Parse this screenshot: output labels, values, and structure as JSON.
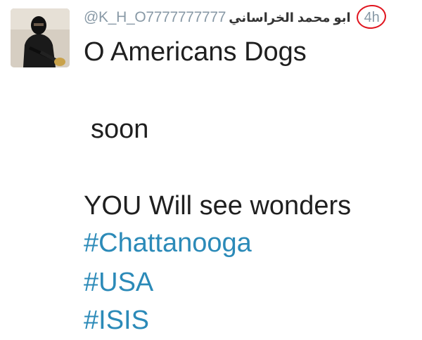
{
  "tweet": {
    "handle": "@K_H_O7777777777",
    "display_name": "ابو محمد الخراساني",
    "timestamp": "4h",
    "highlight_color": "#e0141e",
    "lines": [
      "O Americans Dogs",
      "soon",
      "YOU Will see wonders"
    ],
    "hashtags": [
      "#Chattanooga",
      "#USA",
      "#ISIS"
    ],
    "hashtag_color": "#2b8ab8",
    "text_color": "#1f1f1f",
    "meta_color": "#8899a6"
  }
}
